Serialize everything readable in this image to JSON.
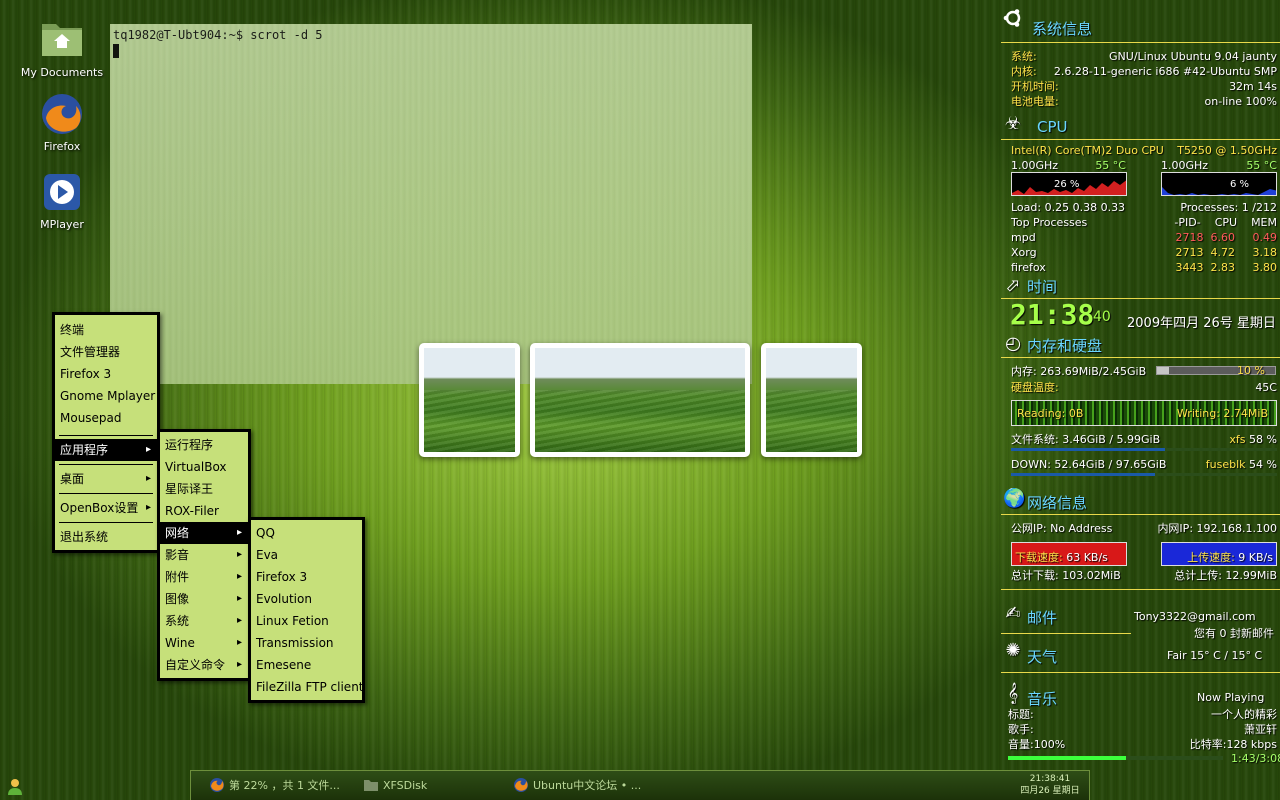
{
  "desktop": {
    "icons": [
      {
        "label": "My Documents",
        "icon": "folder-icon"
      },
      {
        "label": "Firefox",
        "icon": "firefox-icon"
      },
      {
        "label": "MPlayer",
        "icon": "mplayer-icon"
      }
    ]
  },
  "terminal": {
    "prompt": "tq1982@T-Ubt904:~$ scrot -d 5"
  },
  "menu": {
    "main": [
      "终端",
      "文件管理器",
      "Firefox 3",
      "Gnome Mplayer",
      "Mousepad",
      "应用程序",
      "桌面",
      "OpenBox设置",
      "退出系统"
    ],
    "apps": [
      "运行程序",
      "VirtualBox",
      "星际译王",
      "ROX-Filer",
      "网络",
      "影音",
      "附件",
      "图像",
      "系统",
      "Wine",
      "自定义命令"
    ],
    "network": [
      "QQ",
      "Eva",
      "Firefox 3",
      "Evolution",
      "Linux Fetion",
      "Transmission",
      "Emesene",
      "FileZilla FTP client"
    ]
  },
  "taskbar": {
    "tasks": [
      "第 22% ，共 1 文件...",
      "XFSDisk",
      "Ubuntu中文论坛 • ..."
    ],
    "clock_time": "21:38:41",
    "clock_date": "四月26 星期日"
  },
  "conky": {
    "sysinfo": {
      "title": "系统信息",
      "system_label": "系统:",
      "system_value": "GNU/Linux Ubuntu 9.04 jaunty",
      "kernel_label": "内核:",
      "kernel_value": "2.6.28-11-generic i686 #42-Ubuntu SMP",
      "uptime_label": "开机时间:",
      "uptime_value": "32m 14s",
      "battery_label": "电池电量:",
      "battery_value": "on-line 100%"
    },
    "cpu": {
      "title": "CPU",
      "model": "Intel(R) Core(TM)2 Duo CPU",
      "model_speed": "T5250  @ 1.50GHz",
      "core1_freq": "1.00GHz",
      "core1_temp": "55  °C",
      "core2_freq": "1.00GHz",
      "core2_temp": "55  °C",
      "core1_usage": "26 %",
      "core2_usage": "6  %",
      "core1_usage_value": 26,
      "core2_usage_value": 6,
      "load": "Load:  0.25 0.38 0.33",
      "processes": "Processes: 1 /212",
      "top_label": "Top Processes",
      "pid_label": "-PID-",
      "cpu_label": "CPU",
      "mem_label": "MEM",
      "top": [
        {
          "name": "mpd",
          "pid": "2718",
          "cpu": "6.60",
          "mem": "0.49"
        },
        {
          "name": "Xorg",
          "pid": "2713",
          "cpu": "4.72",
          "mem": "3.18"
        },
        {
          "name": "firefox",
          "pid": "3443",
          "cpu": "2.83",
          "mem": "3.80"
        }
      ]
    },
    "time": {
      "title": "时间",
      "clock": "21:38",
      "seconds": "40",
      "date": "2009年四月 26号 星期日"
    },
    "memory": {
      "title": "内存和硬盘",
      "mem_text": "内存: 263.69MiB/2.45GiB",
      "mem_pct": "10 %",
      "mem_pct_value": 10,
      "disk_temp_label": "硬盘温度:",
      "disk_temp": "45C",
      "reading": "Reading: 0B",
      "writing": "Writing: 2.74MiB",
      "fs1_text": "文件系统: 3.46GiB  / 5.99GiB",
      "fs1_type": "xfs",
      "fs1_pct": "58 %",
      "fs1_pct_value": 58,
      "fs2_text": "DOWN:  52.64GiB / 97.65GiB",
      "fs2_type": "fuseblk",
      "fs2_pct": "54 %",
      "fs2_pct_value": 54
    },
    "network": {
      "title": "网络信息",
      "public_ip": "公网IP: No Address",
      "lan_ip": "内网IP: 192.168.1.100",
      "down_label": "下载速度:",
      "down_speed": "63   KB/s",
      "up_label": "上传速度:",
      "up_speed": "9   KB/s",
      "total_down": "总计下载: 103.02MiB",
      "total_up": "总计上传:  12.99MiB"
    },
    "mail": {
      "title": "邮件",
      "address": "Tony3322@gmail.com",
      "status": "您有  0 封新邮件"
    },
    "weather": {
      "title": "天气",
      "value": "Fair 15° C / 15° C"
    },
    "music": {
      "title": "音乐",
      "now_playing": "Now Playing",
      "title_label": "标题:",
      "song": "一个人的精彩",
      "artist_label": "歌手:",
      "artist": "萧亚轩",
      "volume": "音量:100%",
      "bitrate": "比特率:128 kbps",
      "progress_text": "1:43/3:08",
      "progress_value": 0.548
    }
  },
  "colors": {
    "menu_bg": "#c6e07a",
    "conky_title": "#6ad6ff",
    "conky_label": "#ffe34a",
    "conky_line": "#e9d94a"
  }
}
